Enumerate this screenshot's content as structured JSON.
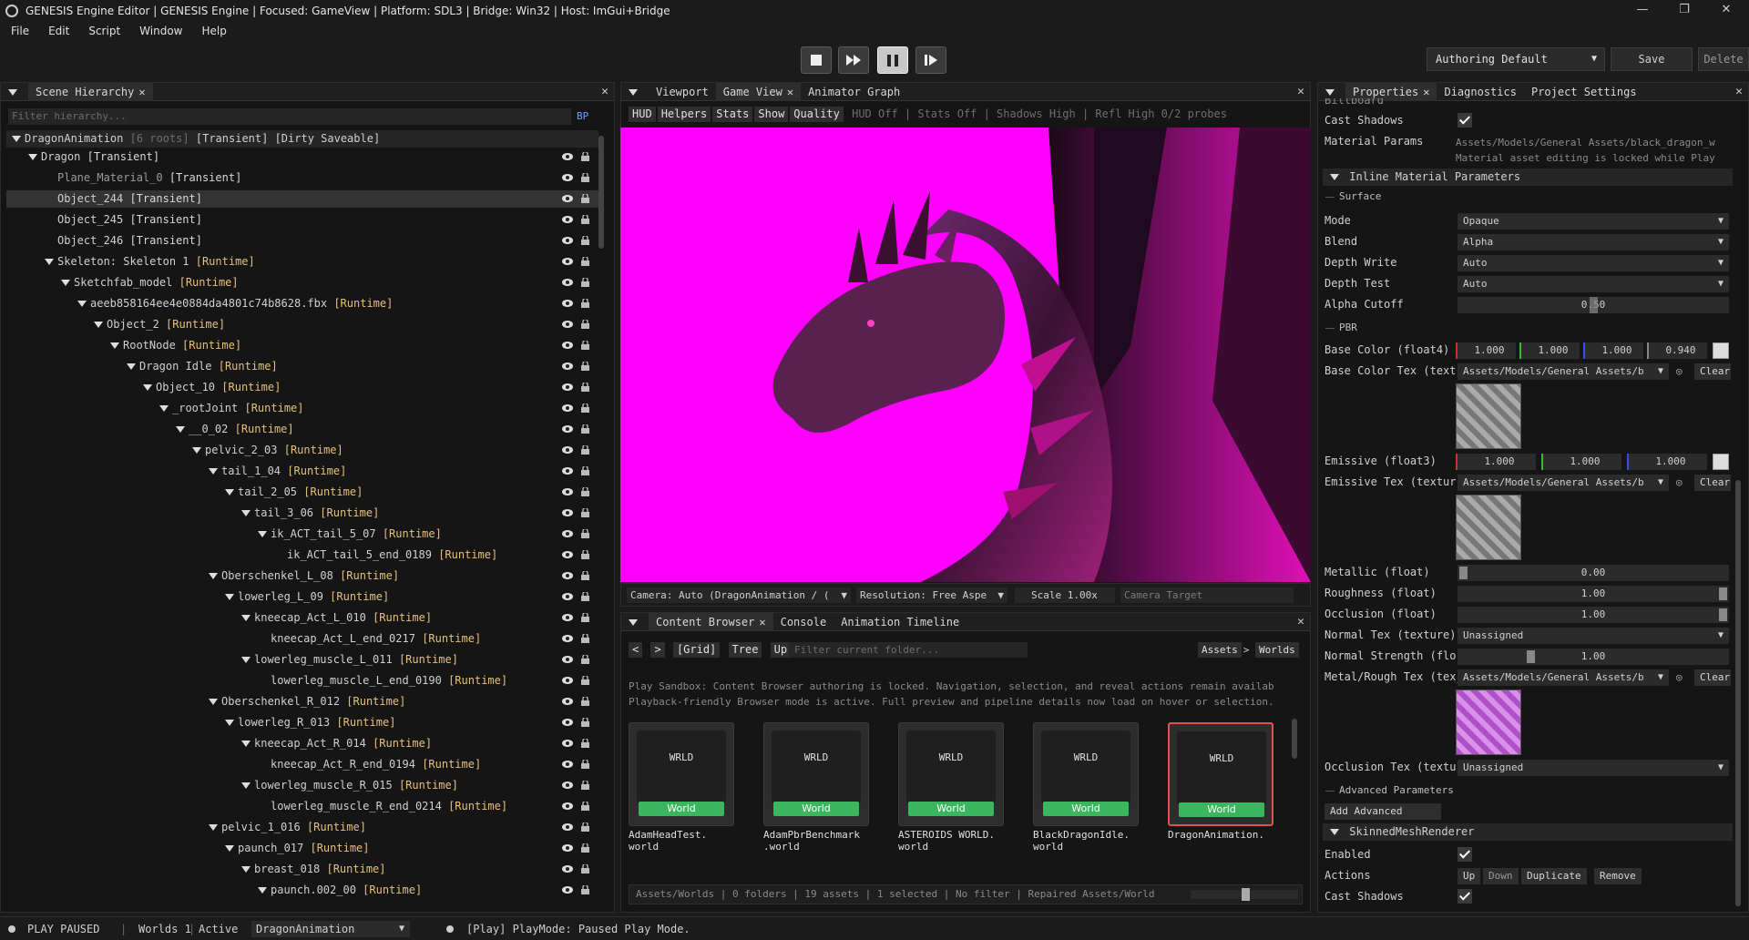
{
  "window": {
    "title": "GENESIS Engine Editor | GENESIS Engine | Focused: GameView | Platform: SDL3 | Bridge: Win32 | Host: ImGui+Bridge",
    "minimize": "—",
    "maximize": "❐",
    "close": "✕"
  },
  "menu": [
    "File",
    "Edit",
    "Script",
    "Window",
    "Help"
  ],
  "toolbar": {
    "profile": "Authoring Default",
    "save": "Save",
    "delete": "Delete"
  },
  "hierarchy": {
    "tab": "Scene Hierarchy",
    "filter_placeholder": "Filter hierarchy...",
    "bp": "BP",
    "root": {
      "name": "DragonAnimation",
      "count": "[6 roots]",
      "flags": "[Transient] [Dirty Saveable]"
    },
    "rows": [
      {
        "name": "Dragon",
        "tag": "[Transient]",
        "depth": 1,
        "arrow": true,
        "tagstyle": "w"
      },
      {
        "name": "Plane_Material_0",
        "tag": "[Transient]",
        "depth": 2,
        "arrow": false,
        "tagstyle": "w",
        "dim": true
      },
      {
        "name": "Object_244",
        "tag": "[Transient]",
        "depth": 2,
        "arrow": false,
        "tagstyle": "w",
        "selected": true
      },
      {
        "name": "Object_245",
        "tag": "[Transient]",
        "depth": 2,
        "arrow": false,
        "tagstyle": "w"
      },
      {
        "name": "Object_246",
        "tag": "[Transient]",
        "depth": 2,
        "arrow": false,
        "tagstyle": "w"
      },
      {
        "name": "Skeleton: Skeleton 1",
        "tag": "[Runtime]",
        "depth": 2,
        "arrow": true
      },
      {
        "name": "Sketchfab_model",
        "tag": "[Runtime]",
        "depth": 3,
        "arrow": true
      },
      {
        "name": "aeeb858164ee4e0884da4801c74b8628.fbx",
        "tag": "[Runtime]",
        "depth": 4,
        "arrow": true
      },
      {
        "name": "Object_2",
        "tag": "[Runtime]",
        "depth": 5,
        "arrow": true
      },
      {
        "name": "RootNode",
        "tag": "[Runtime]",
        "depth": 6,
        "arrow": true
      },
      {
        "name": "Dragon Idle",
        "tag": "[Runtime]",
        "depth": 7,
        "arrow": true
      },
      {
        "name": "Object_10",
        "tag": "[Runtime]",
        "depth": 8,
        "arrow": true
      },
      {
        "name": "_rootJoint",
        "tag": "[Runtime]",
        "depth": 9,
        "arrow": true
      },
      {
        "name": "__0_02",
        "tag": "[Runtime]",
        "depth": 10,
        "arrow": true
      },
      {
        "name": "pelvic_2_03",
        "tag": "[Runtime]",
        "depth": 11,
        "arrow": true
      },
      {
        "name": "tail_1_04",
        "tag": "[Runtime]",
        "depth": 12,
        "arrow": true
      },
      {
        "name": "tail_2_05",
        "tag": "[Runtime]",
        "depth": 13,
        "arrow": true
      },
      {
        "name": "tail_3_06",
        "tag": "[Runtime]",
        "depth": 14,
        "arrow": true
      },
      {
        "name": "ik_ACT_tail_5_07",
        "tag": "[Runtime]",
        "depth": 15,
        "arrow": true
      },
      {
        "name": "ik_ACT_tail_5_end_0189",
        "tag": "[Runtime]",
        "depth": 16,
        "arrow": false
      },
      {
        "name": "Oberschenkel_L_08",
        "tag": "[Runtime]",
        "depth": 12,
        "arrow": true
      },
      {
        "name": "lowerleg_L_09",
        "tag": "[Runtime]",
        "depth": 13,
        "arrow": true
      },
      {
        "name": "kneecap_Act_L_010",
        "tag": "[Runtime]",
        "depth": 14,
        "arrow": true
      },
      {
        "name": "kneecap_Act_L_end_0217",
        "tag": "[Runtime]",
        "depth": 15,
        "arrow": false
      },
      {
        "name": "lowerleg_muscle_L_011",
        "tag": "[Runtime]",
        "depth": 14,
        "arrow": true
      },
      {
        "name": "lowerleg_muscle_L_end_0190",
        "tag": "[Runtime]",
        "depth": 15,
        "arrow": false
      },
      {
        "name": "Oberschenkel_R_012",
        "tag": "[Runtime]",
        "depth": 12,
        "arrow": true
      },
      {
        "name": "lowerleg_R_013",
        "tag": "[Runtime]",
        "depth": 13,
        "arrow": true
      },
      {
        "name": "kneecap_Act_R_014",
        "tag": "[Runtime]",
        "depth": 14,
        "arrow": true
      },
      {
        "name": "kneecap_Act_R_end_0194",
        "tag": "[Runtime]",
        "depth": 15,
        "arrow": false
      },
      {
        "name": "lowerleg_muscle_R_015",
        "tag": "[Runtime]",
        "depth": 14,
        "arrow": true
      },
      {
        "name": "lowerleg_muscle_R_end_0214",
        "tag": "[Runtime]",
        "depth": 15,
        "arrow": false
      },
      {
        "name": "pelvic_1_016",
        "tag": "[Runtime]",
        "depth": 12,
        "arrow": true
      },
      {
        "name": "paunch_017",
        "tag": "[Runtime]",
        "depth": 13,
        "arrow": true
      },
      {
        "name": "breast_018",
        "tag": "[Runtime]",
        "depth": 14,
        "arrow": true
      },
      {
        "name": "paunch.002_00",
        "tag": "[Runtime]",
        "depth": 15,
        "arrow": true
      }
    ]
  },
  "viewport": {
    "tabs": [
      "Viewport",
      "Game View",
      "Animator Graph"
    ],
    "active_tab": "Game View",
    "chips": [
      "HUD",
      "Helpers",
      "Stats",
      "Show",
      "Quality"
    ],
    "status_line": "HUD Off | Stats Off | Shadows High | Refl High 0/2 probes",
    "camera": "Camera: Auto (DragonAnimation / (",
    "resolution": "Resolution: Free Aspe",
    "scale": "Scale 1.00x",
    "camera_target": "Camera Target",
    "background_color": "#ff00ff"
  },
  "content_browser": {
    "tabs": [
      "Content Browser",
      "Console",
      "Animation Timeline"
    ],
    "nav": {
      "back": "<",
      "forward": ">",
      "grid": "[Grid]",
      "tree": "Tree",
      "up": "Up"
    },
    "filter_placeholder": "Filter current folder...",
    "breadcrumb": [
      "Assets",
      ">",
      "Worlds"
    ],
    "info1": "Play Sandbox: Content Browser authoring is locked. Navigation, selection, and reveal actions remain availab",
    "info2": "Playback-friendly Browser mode is active. Full preview and pipeline details now load on hover or selection.",
    "assets": [
      {
        "thumb": "WRLD",
        "badge": "World",
        "name": "AdamHeadTest.\nworld"
      },
      {
        "thumb": "WRLD",
        "badge": "World",
        "name": "AdamPbrBenchmark\n.world"
      },
      {
        "thumb": "WRLD",
        "badge": "World",
        "name": "ASTEROIDS WORLD.\nworld"
      },
      {
        "thumb": "WRLD",
        "badge": "World",
        "name": "BlackDragonIdle.\nworld"
      },
      {
        "thumb": "WRLD",
        "badge": "World",
        "name": "DragonAnimation.",
        "selected": true
      }
    ],
    "footer": "Assets/Worlds | 0 folders | 19 assets | 1 selected | No filter | Repaired Assets/World"
  },
  "properties": {
    "tabs": [
      "Properties",
      "Diagnostics",
      "Project Settings"
    ],
    "top_cut": "Billboard",
    "cast_shadows": "Cast Shadows",
    "material_params": "Material Params",
    "material_path": "Assets/Models/General Assets/black_dragon_w",
    "material_locked": "Material asset editing is locked while Play",
    "inline_header": "Inline Material Parameters",
    "surface": "Surface",
    "mode": {
      "label": "Mode",
      "value": "Opaque"
    },
    "blend": {
      "label": "Blend",
      "value": "Alpha"
    },
    "depth_write": {
      "label": "Depth Write",
      "value": "Auto"
    },
    "depth_test": {
      "label": "Depth Test",
      "value": "Auto"
    },
    "alpha_cutoff": {
      "label": "Alpha Cutoff",
      "value": "0.50"
    },
    "pbr": "PBR",
    "base_color": {
      "label": "Base Color (float4)",
      "values": [
        "1.000",
        "1.000",
        "1.000",
        "0.940"
      ]
    },
    "base_color_tex": {
      "label": "Base Color Tex (text",
      "value": "Assets/Models/General Assets/b"
    },
    "emissive": {
      "label": "Emissive (float3)",
      "values": [
        "1.000",
        "1.000",
        "1.000"
      ]
    },
    "emissive_tex": {
      "label": "Emissive Tex (textur",
      "value": "Assets/Models/General Assets/b"
    },
    "metallic": {
      "label": "Metallic (float)",
      "value": "0.00"
    },
    "roughness": {
      "label": "Roughness (float)",
      "value": "1.00"
    },
    "occlusion": {
      "label": "Occlusion (float)",
      "value": "1.00"
    },
    "normal_tex": {
      "label": "Normal Tex (texture)",
      "value": "Unassigned"
    },
    "normal_strength": {
      "label": "Normal Strength (flo",
      "value": "1.00"
    },
    "metal_rough_tex": {
      "label": "Metal/Rough Tex (tex",
      "value": "Assets/Models/General Assets/b"
    },
    "occlusion_tex": {
      "label": "Occlusion Tex (textu",
      "value": "Unassigned"
    },
    "clear": "Clear",
    "advanced": "Advanced Parameters",
    "add_advanced": "Add Advanced Parameter",
    "skinned_header": "SkinnedMeshRenderer",
    "enabled": "Enabled",
    "actions": "Actions",
    "action_buttons": [
      "Up",
      "Down",
      "Duplicate",
      "Remove"
    ],
    "cast_shadows2": "Cast Shadows"
  },
  "status": {
    "play_state": "PLAY PAUSED",
    "worlds": "Worlds 1",
    "active_label": "Active",
    "active_world": "DragonAnimation",
    "message": "[Play] PlayMode: Paused Play Mode."
  }
}
